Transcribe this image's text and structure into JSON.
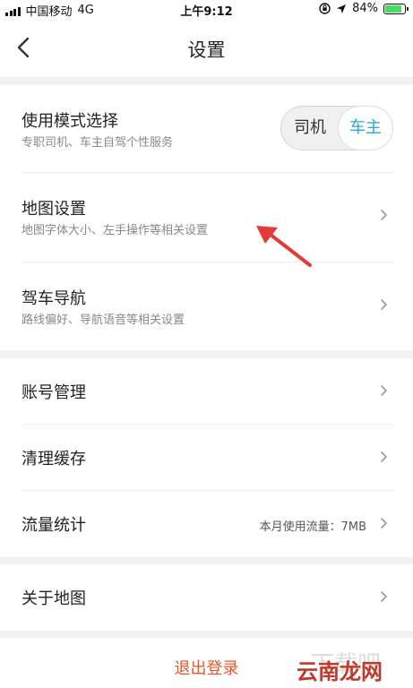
{
  "status_bar": {
    "carrier": "中国移动",
    "network": "4G",
    "time": "上午9:12",
    "battery": "84%",
    "battery_level": 0.84
  },
  "nav": {
    "title": "设置"
  },
  "group1": {
    "mode": {
      "title": "使用模式选择",
      "subtitle": "专职司机、车主自驾个性服务",
      "option_driver": "司机",
      "option_owner": "车主",
      "selected": "车主"
    },
    "map_settings": {
      "title": "地图设置",
      "subtitle": "地图字体大小、左手操作等相关设置"
    },
    "navigation": {
      "title": "驾车导航",
      "subtitle": "路线偏好、导航语音等相关设置"
    }
  },
  "group2": {
    "account": {
      "title": "账号管理"
    },
    "cache": {
      "title": "清理缓存"
    },
    "traffic": {
      "title": "流量统计",
      "value": "本月使用流量：7MB"
    }
  },
  "group3": {
    "about": {
      "title": "关于地图"
    }
  },
  "logout": {
    "label": "退出登录"
  },
  "watermark": {
    "text": "云南龙网"
  },
  "colors": {
    "accent": "#2aa6d6",
    "logout": "#e8552a",
    "annotation": "#e53935",
    "battery": "#4cd964"
  }
}
